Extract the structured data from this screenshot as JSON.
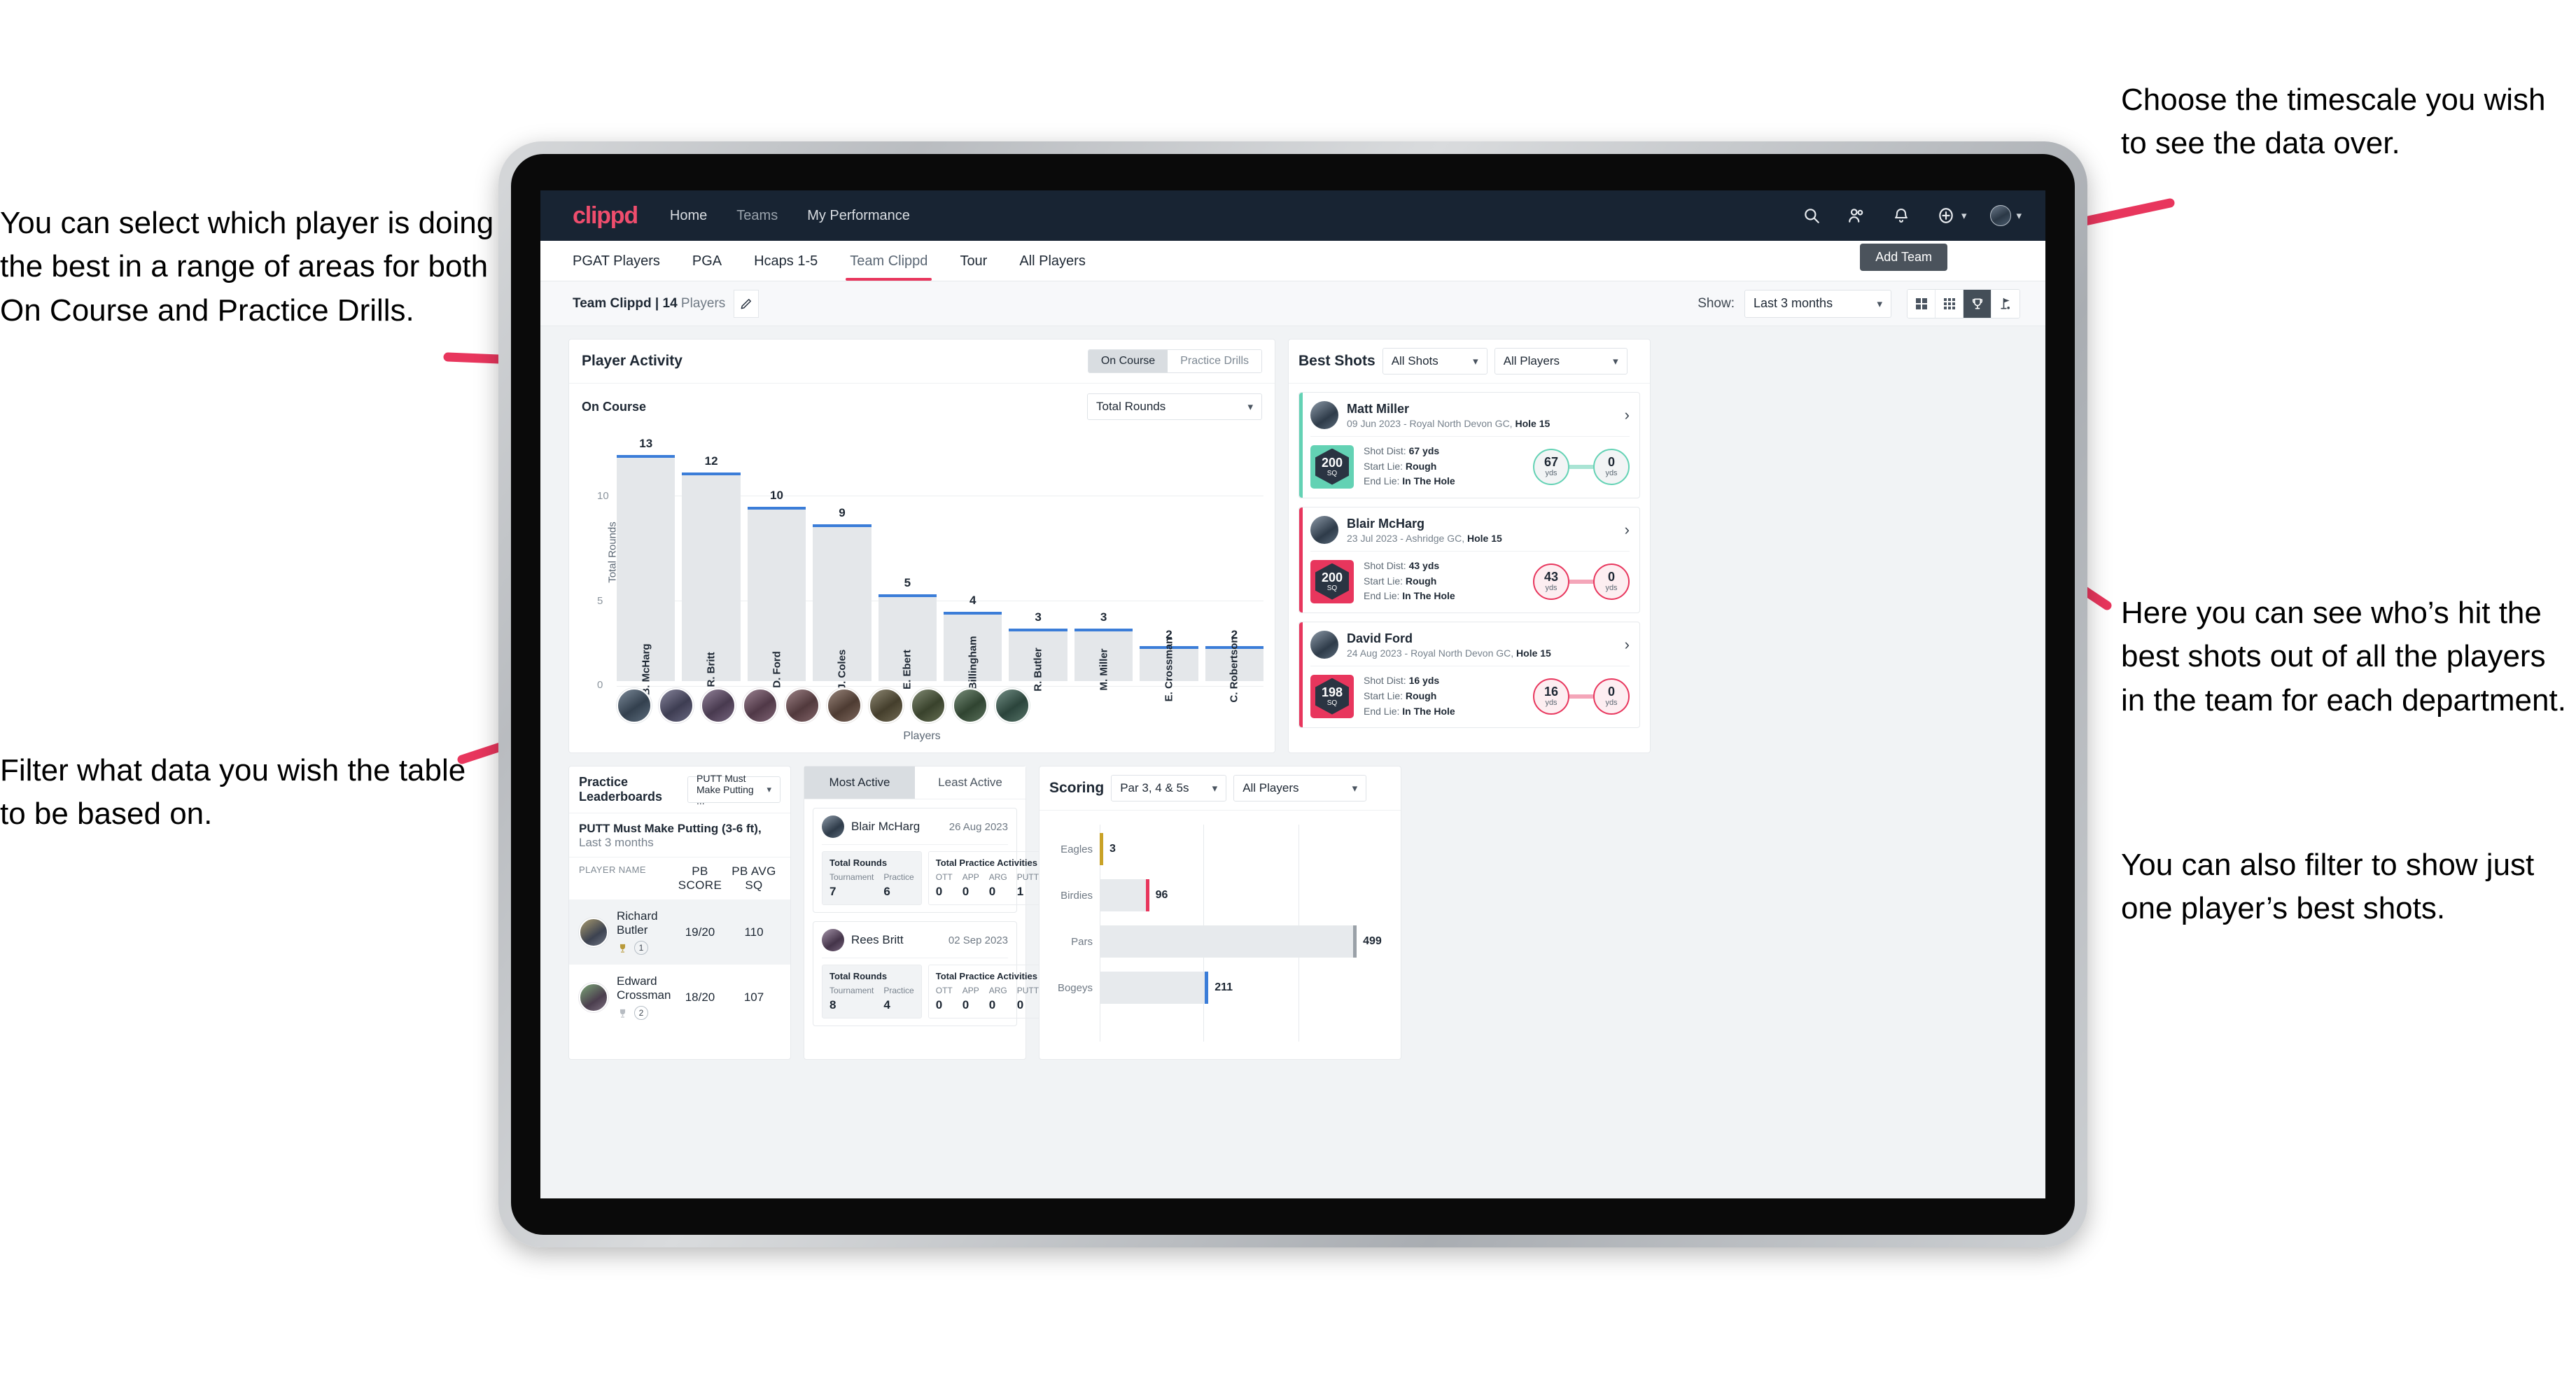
{
  "annotations": {
    "left_top": "You can select which player is doing the best in a range of areas for both On Course and Practice Drills.",
    "left_bottom": "Filter what data you wish the table to be based on.",
    "right_top": "Choose the timescale you wish to see the data over.",
    "right_mid": "Here you can see who’s hit the best shots out of all the players in the team for each department.",
    "right_bottom": "You can also filter to show just one player’s best shots."
  },
  "topnav": {
    "logo": "clippd",
    "links": [
      "Home",
      "Teams",
      "My Performance"
    ],
    "icons": [
      "search-icon",
      "people-icon",
      "bell-icon",
      "plus-circle-icon",
      "avatar"
    ]
  },
  "tabs": {
    "items": [
      "PGAT Players",
      "PGA",
      "Hcaps 1-5",
      "Team Clippd",
      "Tour",
      "All Players"
    ],
    "active": "Team Clippd",
    "tooltip": "Add Team"
  },
  "subheader": {
    "team_name": "Team Clippd",
    "player_count": "14",
    "players_word": "Players",
    "separator": "|",
    "show_label": "Show:",
    "timescale": "Last 3 months",
    "view_toggles": [
      "grid-large-icon",
      "grid-small-icon",
      "trophy-icon",
      "flag-icon"
    ],
    "view_selected": "trophy-icon"
  },
  "player_activity": {
    "title": "Player Activity",
    "segments": [
      "On Course",
      "Practice Drills"
    ],
    "segment_active": "On Course",
    "sub_label": "On Course",
    "metric": "Total Rounds"
  },
  "best_shots": {
    "title": "Best Shots",
    "filter_shots": "All Shots",
    "filter_players": "All Players",
    "cards": [
      {
        "name": "Matt Miller",
        "meta_date": "09 Jun 2023 - Royal North Devon GC,",
        "meta_hole": "Hole 15",
        "sq": "200",
        "sq_unit": "SQ",
        "accent": "teal",
        "shot_dist_label": "Shot Dist:",
        "shot_dist": "67 yds",
        "start_lie_label": "Start Lie:",
        "start_lie": "Rough",
        "end_lie_label": "End Lie:",
        "end_lie": "In The Hole",
        "from_value": "67",
        "from_unit": "yds",
        "to_value": "0",
        "to_unit": "yds"
      },
      {
        "name": "Blair McHarg",
        "meta_date": "23 Jul 2023 - Ashridge GC,",
        "meta_hole": "Hole 15",
        "sq": "200",
        "sq_unit": "SQ",
        "accent": "pink",
        "shot_dist_label": "Shot Dist:",
        "shot_dist": "43 yds",
        "start_lie_label": "Start Lie:",
        "start_lie": "Rough",
        "end_lie_label": "End Lie:",
        "end_lie": "In The Hole",
        "from_value": "43",
        "from_unit": "yds",
        "to_value": "0",
        "to_unit": "yds"
      },
      {
        "name": "David Ford",
        "meta_date": "24 Aug 2023 - Royal North Devon GC,",
        "meta_hole": "Hole 15",
        "sq": "198",
        "sq_unit": "SQ",
        "accent": "pink",
        "shot_dist_label": "Shot Dist:",
        "shot_dist": "16 yds",
        "start_lie_label": "Start Lie:",
        "start_lie": "Rough",
        "end_lie_label": "End Lie:",
        "end_lie": "In The Hole",
        "from_value": "16",
        "from_unit": "yds",
        "to_value": "0",
        "to_unit": "yds"
      }
    ]
  },
  "practice_leaderboards": {
    "title": "Practice Leaderboards",
    "drill_select": "PUTT Must Make Putting ...",
    "sub_bold": "PUTT Must Make Putting (3-6 ft),",
    "sub_light": "Last 3 months",
    "columns": [
      "PLAYER NAME",
      "PB SCORE",
      "PB AVG SQ"
    ],
    "rows": [
      {
        "name": "Richard Butler",
        "rank": "1",
        "pb_score": "19/20",
        "pb_avg_sq": "110",
        "trophy": "gold"
      },
      {
        "name": "Edward Crossman",
        "rank": "2",
        "pb_score": "18/20",
        "pb_avg_sq": "107",
        "trophy": "silver"
      }
    ]
  },
  "activity_panel": {
    "tabs": [
      "Most Active",
      "Least Active"
    ],
    "tab_active": "Most Active",
    "rounds_title": "Total Rounds",
    "rounds_cols": [
      "Tournament",
      "Practice"
    ],
    "practice_title": "Total Practice Activities",
    "practice_cols": [
      "OTT",
      "APP",
      "ARG",
      "PUTT"
    ],
    "items": [
      {
        "name": "Blair McHarg",
        "date": "26 Aug 2023",
        "tournament": "7",
        "practice": "6",
        "ott": "0",
        "app": "0",
        "arg": "0",
        "putt": "1"
      },
      {
        "name": "Rees Britt",
        "date": "02 Sep 2023",
        "tournament": "8",
        "practice": "4",
        "ott": "0",
        "app": "0",
        "arg": "0",
        "putt": "0"
      }
    ]
  },
  "scoring": {
    "title": "Scoring",
    "filter_par": "Par 3, 4 & 5s",
    "filter_players": "All Players"
  },
  "chart_data": [
    {
      "type": "bar",
      "title": "Player Activity - On Course",
      "xlabel": "Players",
      "ylabel": "Total Rounds",
      "ylim": [
        0,
        14
      ],
      "yticks": [
        0,
        5,
        10
      ],
      "grid": true,
      "categories": [
        "B. McHarg",
        "R. Britt",
        "D. Ford",
        "J. Coles",
        "E. Ebert",
        "D. Billingham",
        "R. Butler",
        "M. Miller",
        "E. Crossman",
        "C. Robertson"
      ],
      "values": [
        13,
        12,
        10,
        9,
        5,
        4,
        3,
        3,
        2,
        2
      ],
      "bar_color": "#e4e7ea",
      "cap_color": "#3b7dd8",
      "legend": []
    },
    {
      "type": "bar",
      "orientation": "horizontal",
      "title": "Scoring",
      "xlabel": "",
      "ylabel": "",
      "categories": [
        "Eagles",
        "Birdies",
        "Pars",
        "Bogeys"
      ],
      "values": [
        3,
        96,
        499,
        211
      ],
      "xlim": [
        0,
        560
      ],
      "grid": true,
      "cap_colors": [
        "#c9a227",
        "#e8365d",
        "#9aa1a8",
        "#3b7dd8"
      ],
      "bar_color": "#e7eaed"
    }
  ]
}
